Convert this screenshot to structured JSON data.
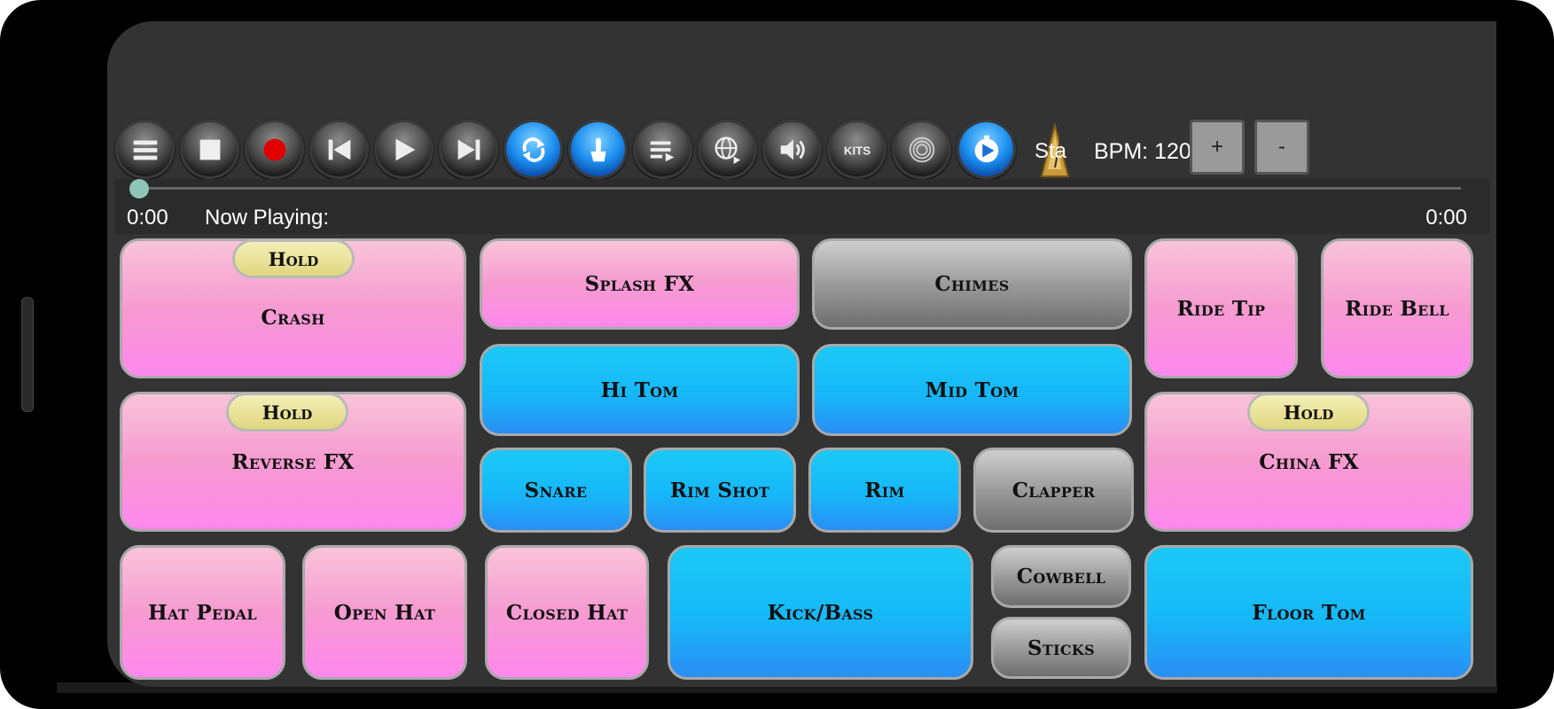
{
  "toolbar": {
    "buttons": [
      {
        "icon": "menu-icon"
      },
      {
        "icon": "stop-icon"
      },
      {
        "icon": "record-icon"
      },
      {
        "icon": "skip-back-icon"
      },
      {
        "icon": "play-icon"
      },
      {
        "icon": "skip-forward-icon"
      },
      {
        "icon": "loop-icon"
      },
      {
        "icon": "touch-icon"
      },
      {
        "icon": "playlist-icon"
      },
      {
        "icon": "globe-icon"
      },
      {
        "icon": "volume-icon"
      },
      {
        "icon": "kits-icon",
        "label": "KITS"
      },
      {
        "icon": "spiral-icon"
      },
      {
        "icon": "timer-icon"
      }
    ],
    "sta_label": "Sta",
    "bpm_label": "BPM: 120",
    "bpm_plus": "+",
    "bpm_minus": "-"
  },
  "player": {
    "time_elapsed": "0:00",
    "now_playing": "Now Playing:",
    "time_total": "0:00",
    "progress": 0
  },
  "pads": {
    "crash": "Crash",
    "splash_fx": "Splash FX",
    "chimes": "Chimes",
    "ride_tip": "Ride Tip",
    "ride_bell": "Ride Bell",
    "hi_tom": "Hi Tom",
    "mid_tom": "Mid Tom",
    "reverse_fx": "Reverse FX",
    "china_fx": "China FX",
    "snare": "Snare",
    "rim_shot": "Rim Shot",
    "rim": "Rim",
    "clapper": "Clapper",
    "hat_pedal": "Hat Pedal",
    "open_hat": "Open Hat",
    "closed_hat": "Closed Hat",
    "kick_bass": "Kick/Bass",
    "cowbell": "Cowbell",
    "sticks": "Sticks",
    "floor_tom": "Floor Tom",
    "hold": "Hold"
  },
  "colors": {
    "pink": "#f69bd0",
    "blue": "#16b8f8",
    "gray": "#9b9b9b",
    "hold": "#e0d67e",
    "seek_thumb": "#8ec5b8"
  }
}
